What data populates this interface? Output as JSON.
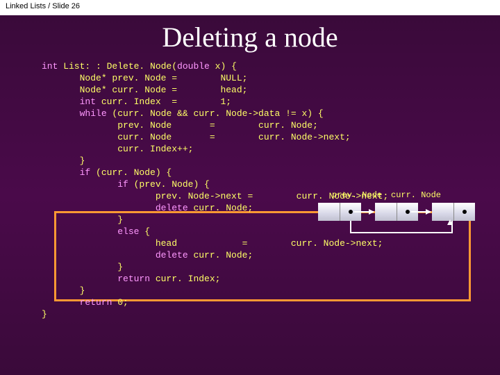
{
  "header": {
    "text": "Linked Lists / Slide 26"
  },
  "title": "Deleting a node",
  "code": {
    "l1a": "int",
    "l1b": " List: : Delete. Node(",
    "l1c": "double",
    "l1d": " x) {",
    "l2": "       Node* prev. Node =        NULL;",
    "l3": "       Node* curr. Node =        head;",
    "l4a": "       ",
    "l4b": "int",
    "l4c": " curr. Index  =        1;",
    "l5a": "       ",
    "l5b": "while",
    "l5c": " (curr. Node && curr. Node->data != x) {",
    "l6": "              prev. Node       =        curr. Node;",
    "l7": "              curr. Node       =        curr. Node->next;",
    "l8": "              curr. Index++;",
    "l9": "       }",
    "l10a": "       ",
    "l10b": "if",
    "l10c": " (curr. Node) {",
    "l11a": "              ",
    "l11b": "if",
    "l11c": " (prev. Node) {",
    "l12": "                     prev. Node->next =        curr. Node->next;",
    "l13a": "                     ",
    "l13b": "delete",
    "l13c": " curr. Node;",
    "l14": "              }",
    "l15a": "              ",
    "l15b": "else",
    "l15c": " {",
    "l16": "                     head            =        curr. Node->next;",
    "l17a": "                     ",
    "l17b": "delete",
    "l17c": " curr. Node;",
    "l18": "              }",
    "l19a": "              ",
    "l19b": "return",
    "l19c": " curr. Index;",
    "l20": "       }",
    "l21a": "       ",
    "l21b": "return",
    "l21c": " 0;",
    "l22": "}"
  },
  "diagram": {
    "label_prev": "prev. Node",
    "label_curr": "curr. Node"
  }
}
